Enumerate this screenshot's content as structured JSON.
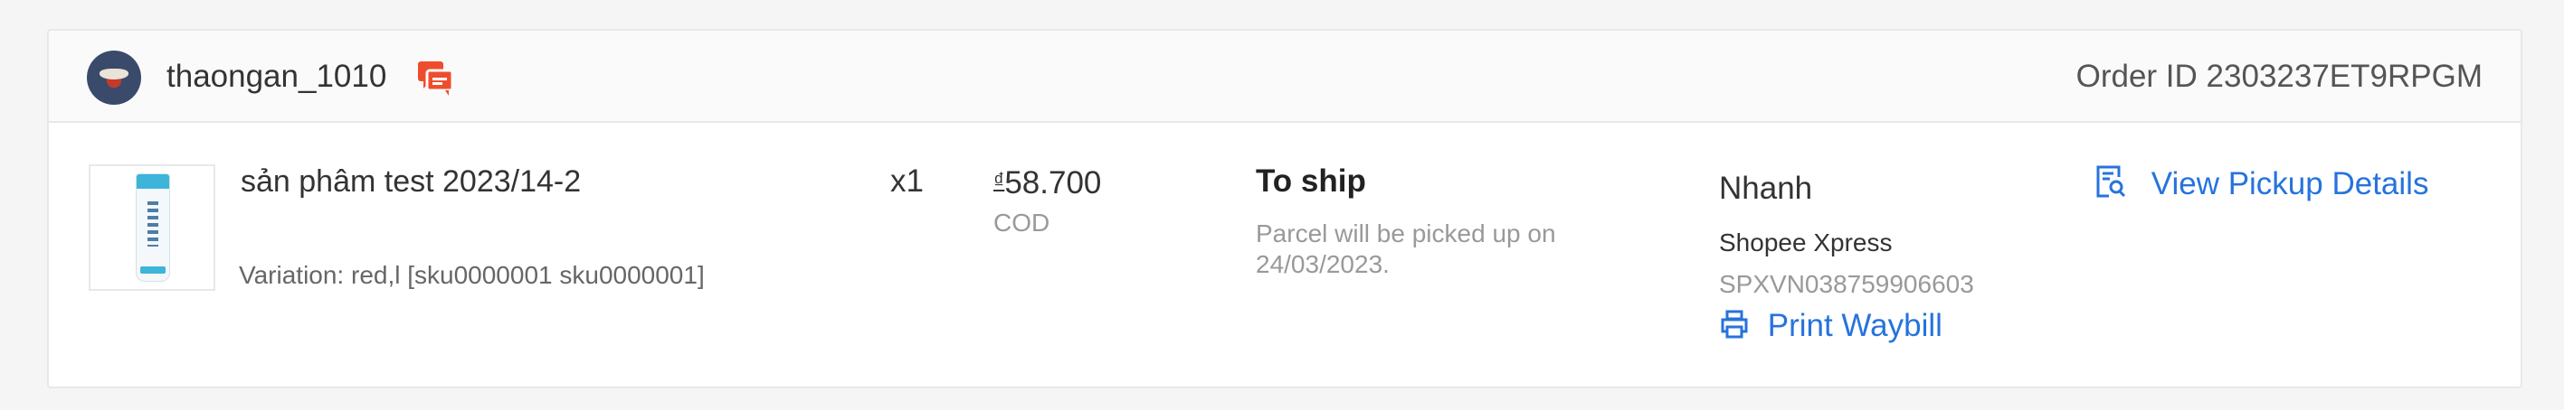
{
  "order": {
    "username": "thaongan_1010",
    "order_id_label": "Order ID",
    "order_id": "2303237ET9RPGM",
    "product": {
      "name": "sản phâm test 2023/14-2",
      "variation": "Variation: red,l [sku0000001 sku0000001]",
      "quantity": "x1",
      "currency_symbol": "₫",
      "price": "58.700",
      "payment_method": "COD"
    },
    "status": {
      "label": "To ship",
      "note": "Parcel will be picked up on 24/03/2023."
    },
    "shipping": {
      "speed": "Nhanh",
      "carrier": "Shopee Xpress",
      "tracking_number": "SPXVN038759906603",
      "print_label": "Print Waybill"
    },
    "actions": {
      "view_pickup_label": "View Pickup Details"
    }
  },
  "icons": {
    "chat": "chat-icon",
    "pickup": "document-search-icon",
    "print": "printer-icon"
  },
  "colors": {
    "link": "#2673dd",
    "chat_icon": "#ee4d2d",
    "header_bg": "#fafafa"
  }
}
